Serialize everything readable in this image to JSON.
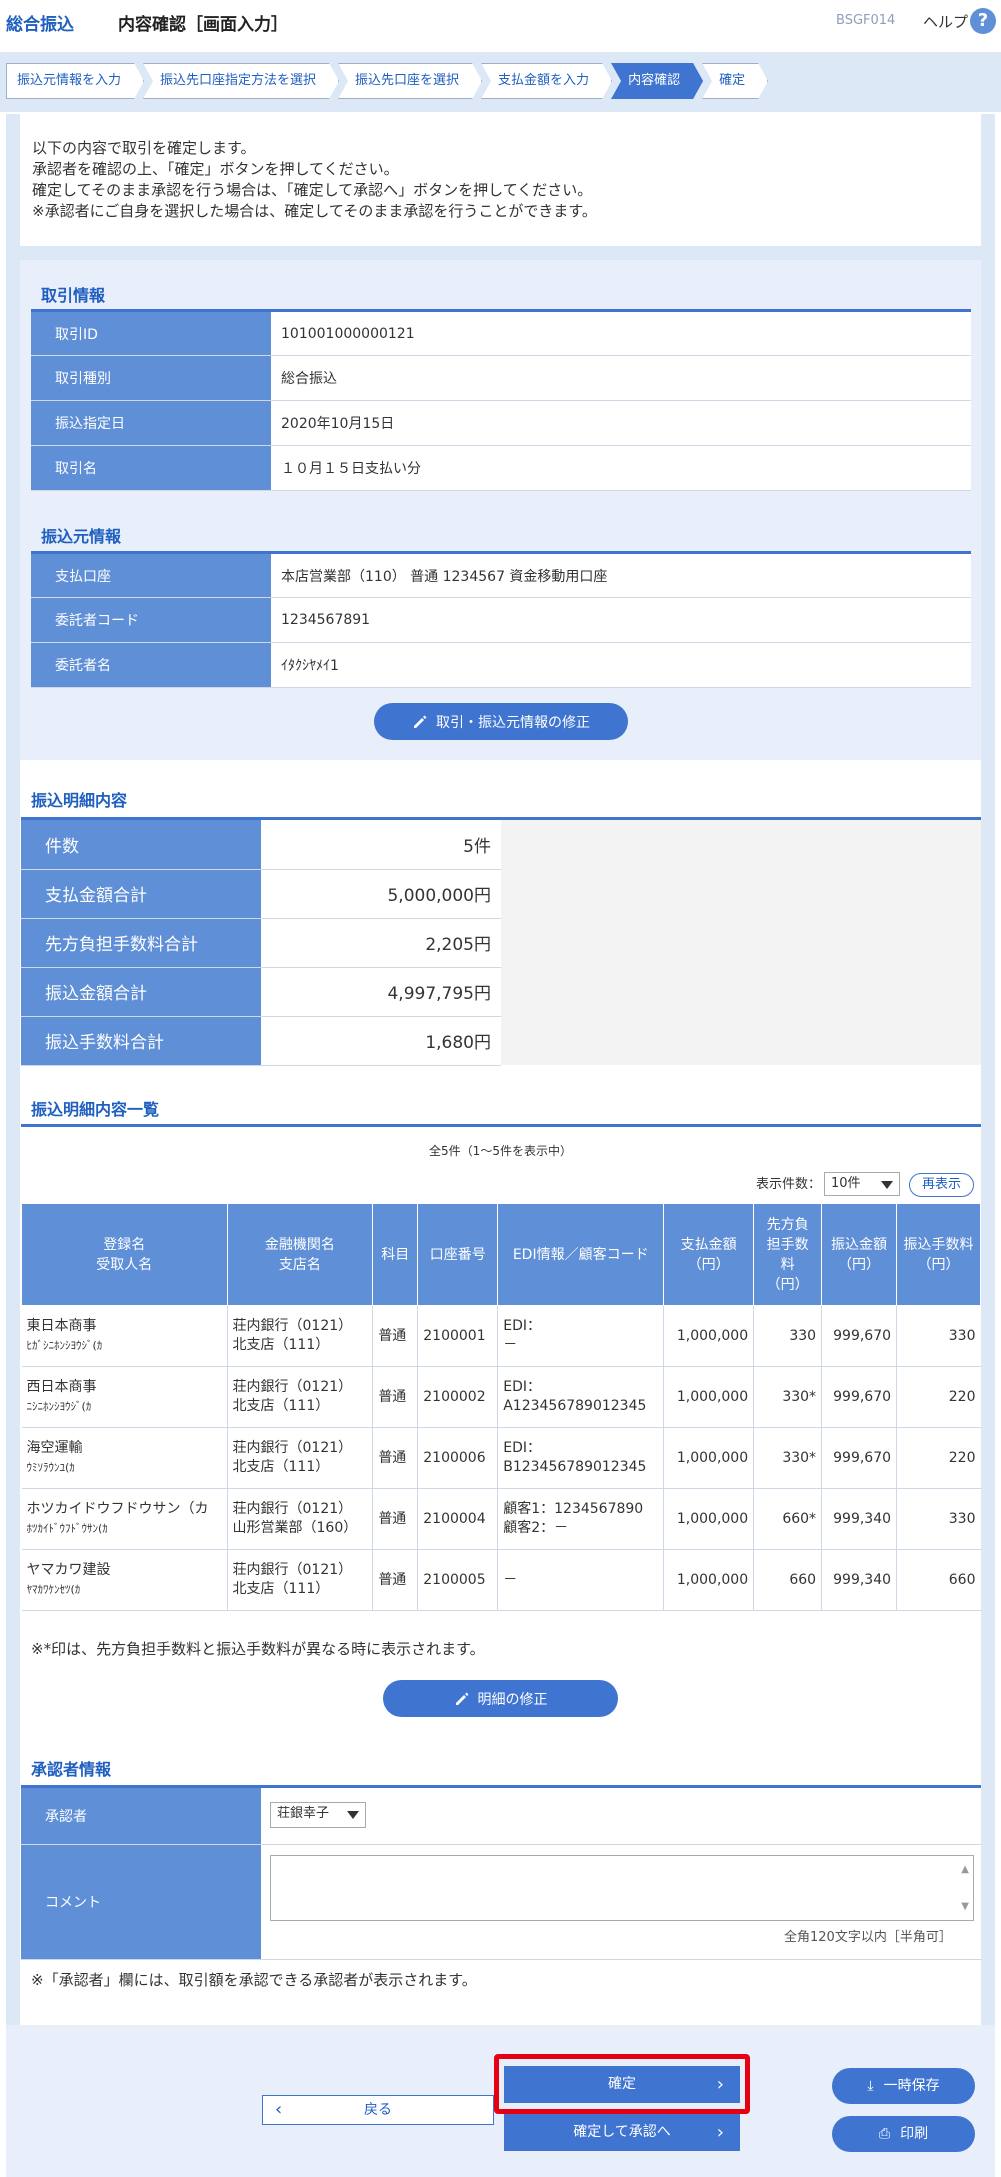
{
  "header": {
    "brand": "総合振込",
    "title": "内容確認［画面入力］",
    "screen_id": "BSGF014",
    "help_label": "ヘルプ",
    "help_icon": "?"
  },
  "steps": [
    {
      "label": "振込元情報を入力"
    },
    {
      "label": "振込先口座指定方法を選択"
    },
    {
      "label": "振込先口座を選択"
    },
    {
      "label": "支払金額を入力"
    },
    {
      "label": "内容確認"
    },
    {
      "label": "確定"
    }
  ],
  "intro": [
    "以下の内容で取引を確定します。",
    "承認者を確認の上、「確定」ボタンを押してください。",
    "確定してそのまま承認を行う場合は、「確定して承認へ」ボタンを押してください。",
    "※承認者にご自身を選択した場合は、確定してそのまま承認を行うことができます。"
  ],
  "transaction": {
    "title": "取引情報",
    "rows": [
      {
        "key": "取引ID",
        "value": "101001000000121"
      },
      {
        "key": "取引種別",
        "value": "総合振込"
      },
      {
        "key": "振込指定日",
        "value": "2020年10月15日"
      },
      {
        "key": "取引名",
        "value": "１０月１５日支払い分"
      }
    ]
  },
  "source": {
    "title": "振込元情報",
    "rows": [
      {
        "key": "支払口座",
        "value": "本店営業部（110） 普通 1234567 資金移動用口座"
      },
      {
        "key": "委託者コード",
        "value": "1234567891"
      },
      {
        "key": "委託者名",
        "value": "ｲﾀｸｼﾔﾒｲ1"
      }
    ],
    "edit_button": "取引・振込元情報の修正"
  },
  "summary": {
    "title": "振込明細内容",
    "rows": [
      {
        "key": "件数",
        "value": "5件"
      },
      {
        "key": "支払金額合計",
        "value": "5,000,000円"
      },
      {
        "key": "先方負担手数料合計",
        "value": "2,205円"
      },
      {
        "key": "振込金額合計",
        "value": "4,997,795円"
      },
      {
        "key": "振込手数料合計",
        "value": "1,680円"
      }
    ]
  },
  "detail_list": {
    "title": "振込明細内容一覧",
    "caption": "全5件（1～5件を表示中）",
    "per_page_label": "表示件数：",
    "per_page_value": "10件",
    "redisplay_button": "再表示",
    "headers": [
      "登録名\n受取人名",
      "金融機関名\n支店名",
      "科目",
      "口座番号",
      "EDI情報／顧客コード",
      "支払金額\n（円）",
      "先方負\n担手数\n料\n（円）",
      "振込金額\n（円）",
      "振込手数料\n（円）"
    ],
    "rows": [
      {
        "name": "東日本商事",
        "kana": "ﾋｶﾞｼﾆﾎﾝｼﾖｳｼﾞ(ｶ",
        "bank": "荘内銀行（0121）",
        "branch": "北支店（111）",
        "type": "普通",
        "account": "2100001",
        "edi1": "EDI：",
        "edi2": "－",
        "amount": "1,000,000",
        "fee_payer": "330",
        "transfer": "999,670",
        "fee": "330"
      },
      {
        "name": "西日本商事",
        "kana": "ﾆｼﾆﾎﾝｼﾖｳｼﾞ(ｶ",
        "bank": "荘内銀行（0121）",
        "branch": "北支店（111）",
        "type": "普通",
        "account": "2100002",
        "edi1": "EDI：",
        "edi2": "A123456789012345",
        "amount": "1,000,000",
        "fee_payer": "330*",
        "transfer": "999,670",
        "fee": "220"
      },
      {
        "name": "海空運輸",
        "kana": "ｳﾐｿﾗｳﾝﾕ(ｶ",
        "bank": "荘内銀行（0121）",
        "branch": "北支店（111）",
        "type": "普通",
        "account": "2100006",
        "edi1": "EDI：",
        "edi2": "B123456789012345",
        "amount": "1,000,000",
        "fee_payer": "330*",
        "transfer": "999,670",
        "fee": "220"
      },
      {
        "name": "ホツカイドウフドウサン（カ",
        "kana": "ﾎﾂｶｲﾄﾞｳﾌﾄﾞｳｻﾝ(ｶ",
        "bank": "荘内銀行（0121）",
        "branch": "山形営業部（160）",
        "type": "普通",
        "account": "2100004",
        "edi1": "顧客1：1234567890",
        "edi2": "顧客2：－",
        "amount": "1,000,000",
        "fee_payer": "660*",
        "transfer": "999,340",
        "fee": "330"
      },
      {
        "name": "ヤマカワ建設",
        "kana": "ﾔﾏｶﾜｹﾝｾﾂ(ｶ",
        "bank": "荘内銀行（0121）",
        "branch": "北支店（111）",
        "type": "普通",
        "account": "2100005",
        "edi1": "－",
        "edi2": "",
        "amount": "1,000,000",
        "fee_payer": "660",
        "transfer": "999,340",
        "fee": "660"
      }
    ],
    "note": "※*印は、先方負担手数料と振込手数料が異なる時に表示されます。",
    "edit_button": "明細の修正"
  },
  "approver": {
    "title": "承認者情報",
    "approver_label": "承認者",
    "approver_value": "荘銀幸子",
    "comment_label": "コメント",
    "comment_placeholder": "",
    "limit": "全角120文字以内［半角可］",
    "note": "※「承認者」欄には、取引額を承認できる承認者が表示されます。"
  },
  "actions": {
    "back": "戻る",
    "confirm": "確定",
    "confirm_approve": "確定して承認へ",
    "save": "一時保存",
    "print": "印刷"
  },
  "colors": {
    "primary": "#3f74d0",
    "highlight": "#e60012"
  }
}
